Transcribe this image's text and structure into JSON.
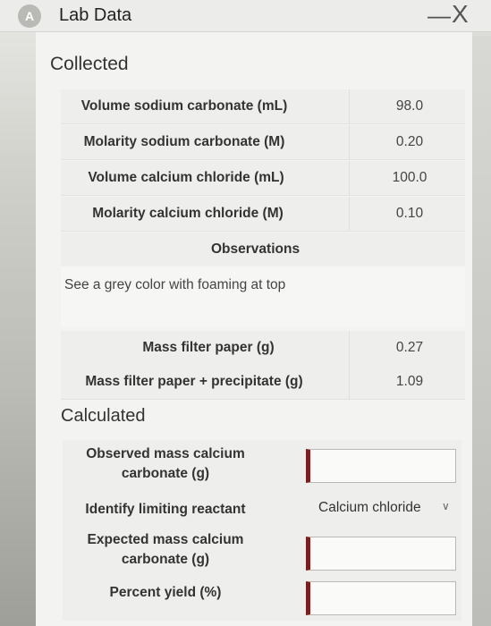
{
  "window": {
    "title": "Lab Data",
    "icon_letter": "A",
    "minimize_glyph": "—",
    "close_glyph": "X"
  },
  "collected": {
    "heading": "Collected",
    "rows": [
      {
        "label": "Volume sodium carbonate (mL)",
        "value": "98.0"
      },
      {
        "label": "Molarity sodium carbonate (M)",
        "value": "0.20"
      },
      {
        "label": "Volume calcium chloride (mL)",
        "value": "100.0"
      },
      {
        "label": "Molarity calcium chloride (M)",
        "value": "0.10"
      }
    ],
    "observations_heading": "Observations",
    "observations_text": "See a grey color with foaming at top",
    "mass_rows": [
      {
        "label": "Mass filter paper (g)",
        "value": "0.27"
      },
      {
        "label": "Mass filter paper + precipitate (g)",
        "value": "1.09"
      }
    ]
  },
  "calculated": {
    "heading": "Calculated",
    "observed_mass_label_1": "Observed mass calcium",
    "observed_mass_label_2": "carbonate (g)",
    "observed_mass_value": "",
    "limiting_label": "Identify limiting reactant",
    "limiting_value": "Calcium chloride",
    "expected_mass_label_1": "Expected mass calcium",
    "expected_mass_label_2": "carbonate (g)",
    "expected_mass_value": "",
    "percent_yield_label": "Percent yield (%)",
    "percent_yield_value": ""
  },
  "colors": {
    "required_field_accent": "#7a1f1f",
    "panel_background": "#f3f3f1"
  }
}
